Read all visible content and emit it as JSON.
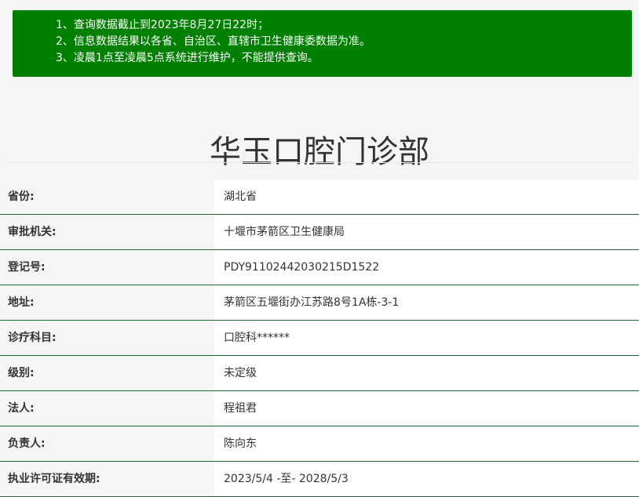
{
  "notice": {
    "lines": [
      "1、查询数据截止到2023年8月27日22时；",
      "2、信息数据结果以各省、自治区、直辖市卫生健康委数据为准。",
      "3、凌晨1点至凌晨5点系统进行维护，不能提供查询。"
    ]
  },
  "clinic": {
    "name": "华玉口腔门诊部"
  },
  "details": [
    {
      "label": "省份:",
      "value": "湖北省"
    },
    {
      "label": "审批机关:",
      "value": "十堰市茅箭区卫生健康局"
    },
    {
      "label": "登记号:",
      "value": "PDY91102442030215D1522"
    },
    {
      "label": "地址:",
      "value": "茅箭区五堰街办江苏路8号1A栋-3-1"
    },
    {
      "label": "诊疗科目:",
      "value": "口腔科******"
    },
    {
      "label": "级别:",
      "value": "未定级"
    },
    {
      "label": "法人:",
      "value": "程祖君"
    },
    {
      "label": "负责人:",
      "value": "陈向东"
    },
    {
      "label": "执业许可证有效期:",
      "value": "2023/5/4 -至- 2028/5/3"
    }
  ],
  "colors": {
    "notice_bg": "#008000",
    "row_border": "#1e6b3a",
    "page_bg": "#f5f5f5",
    "text": "#333333"
  }
}
